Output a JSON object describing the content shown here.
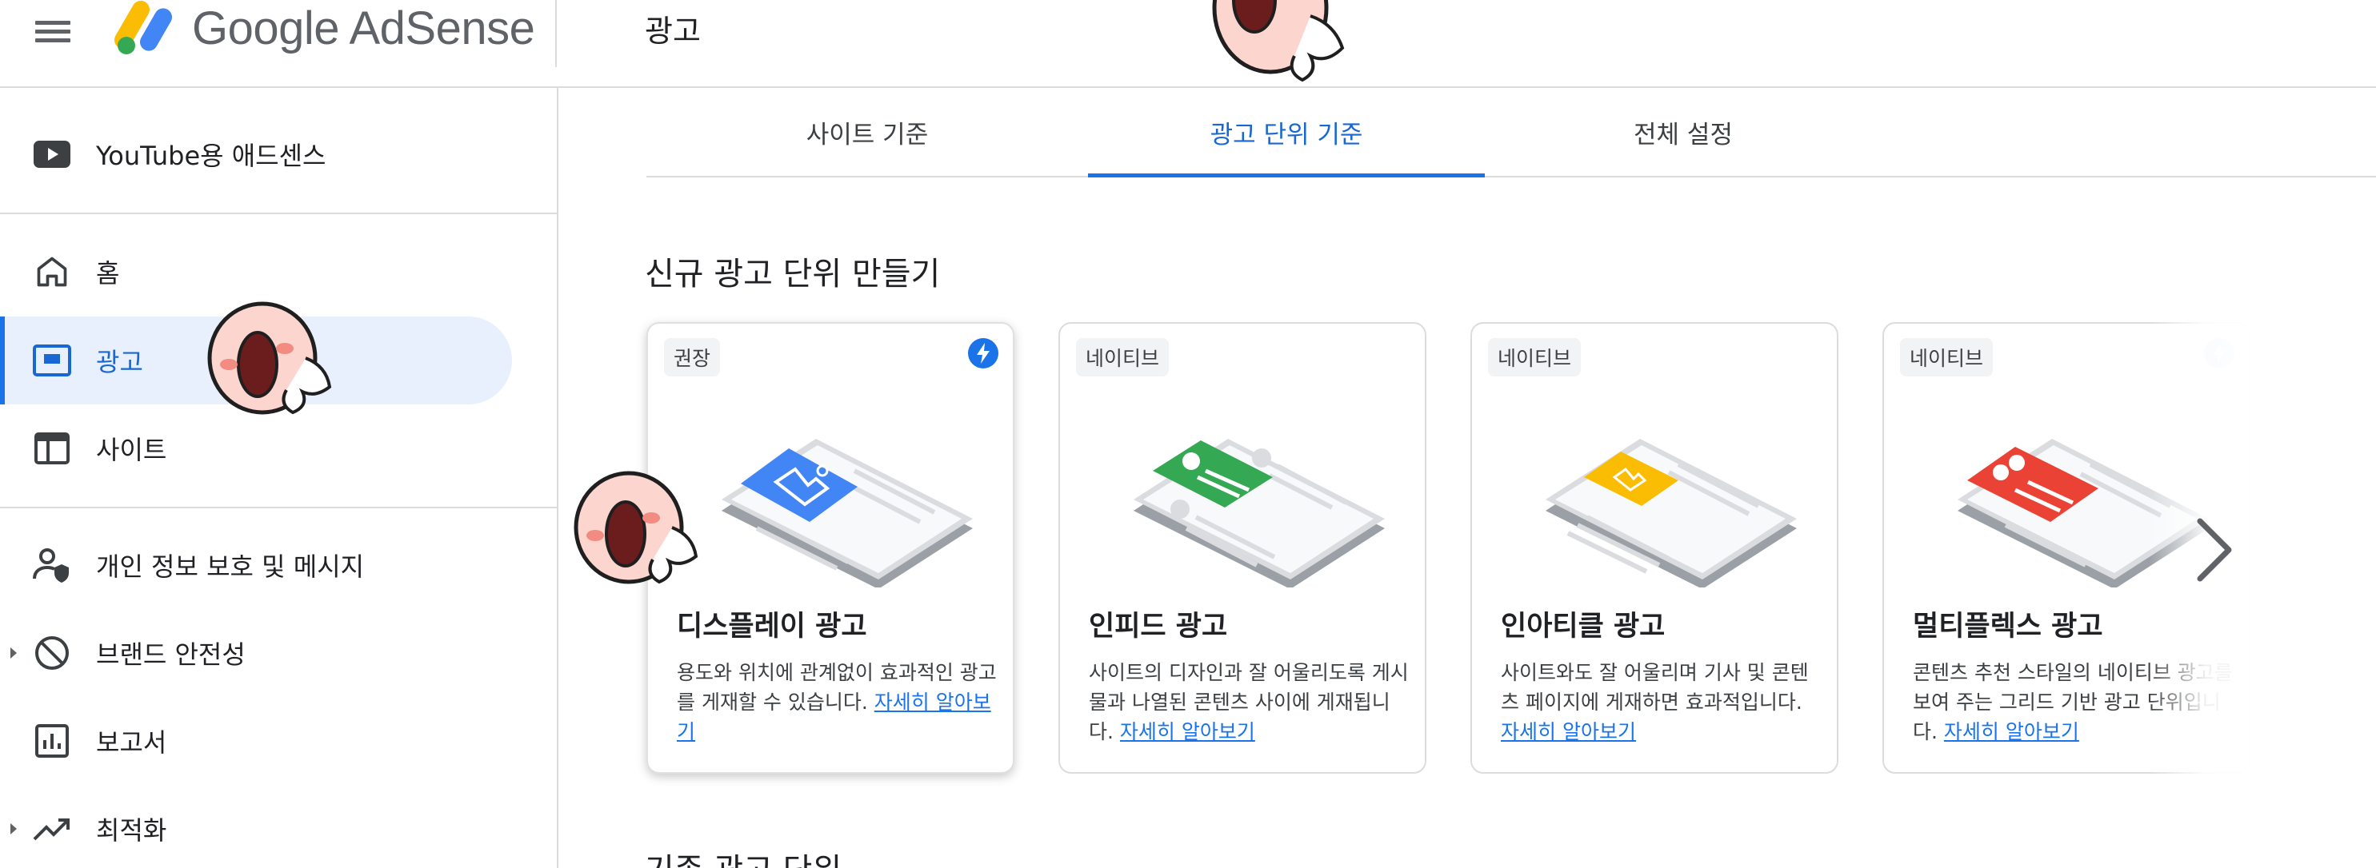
{
  "app": {
    "brand": "Google AdSense",
    "page_title": "광고"
  },
  "sidebar": {
    "items": [
      {
        "label": "YouTube용 애드센스",
        "icon": "youtube-icon"
      },
      {
        "label": "홈",
        "icon": "home-icon"
      },
      {
        "label": "광고",
        "icon": "ads-icon",
        "active": true
      },
      {
        "label": "사이트",
        "icon": "sites-icon"
      },
      {
        "label": "개인 정보 보호 및 메시지",
        "icon": "privacy-icon"
      },
      {
        "label": "브랜드 안전성",
        "icon": "block-icon",
        "expandable": true
      },
      {
        "label": "보고서",
        "icon": "reports-icon"
      },
      {
        "label": "최적화",
        "icon": "trending-icon",
        "expandable": true
      }
    ]
  },
  "tabs": [
    {
      "label": "사이트 기준"
    },
    {
      "label": "광고 단위 기준",
      "active": true
    },
    {
      "label": "전체 설정"
    }
  ],
  "main": {
    "section_title": "신규 광고 단위 만들기",
    "section_title_2": "기존 광고 단위",
    "cards": [
      {
        "badge": "권장",
        "title": "디스플레이 광고",
        "desc": "용도와 위치에 관계없이 효과적인 광고를 게재할 수 있습니다.",
        "link": "자세히 알아보기",
        "accent": "#4285f4"
      },
      {
        "badge": "네이티브",
        "title": "인피드 광고",
        "desc": "사이트의 디자인과 잘 어울리도록 게시물과 나열된 콘텐츠 사이에 게재됩니다.",
        "link": "자세히 알아보기",
        "accent": "#34a853"
      },
      {
        "badge": "네이티브",
        "title": "인아티클 광고",
        "desc": "사이트와도 잘 어울리며 기사 및 콘텐츠 페이지에 게재하면 효과적입니다.",
        "link": "자세히 알아보기",
        "accent": "#fbbc04"
      },
      {
        "badge": "네이티브",
        "title": "멀티플렉스 광고",
        "desc": "콘텐츠 추천 스타일의 네이티브 광고를 보여 주는 그리드 기반 광고 단위입니다.",
        "link": "자세히 알아보기",
        "accent": "#ea4335"
      }
    ]
  },
  "colors": {
    "primary": "#1a73e8",
    "active_bg": "#e8f0fe",
    "divider": "#dadce0",
    "text": "#202124"
  }
}
